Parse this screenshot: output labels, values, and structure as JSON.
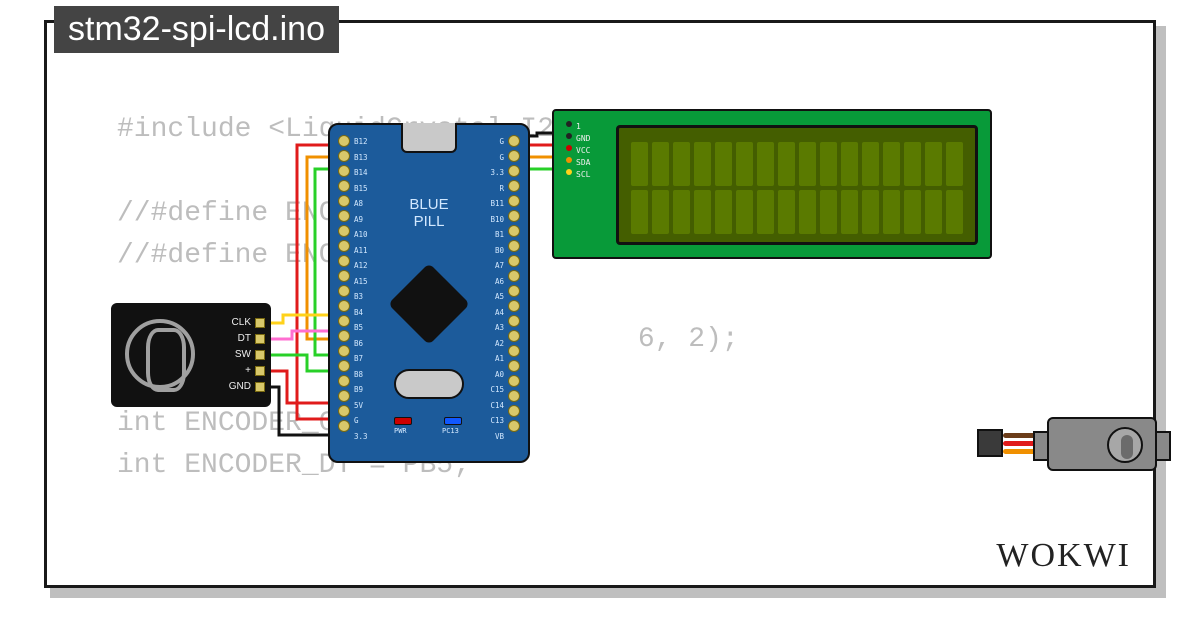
{
  "title": "stm32-spi-lcd.ino",
  "brand": "WOKWI",
  "code_lines": [
    "#include <LiquidCrystal_I2C.h>",
    "",
    "//#define ENCODER_",
    "//#define ENCODER_",
    "",
    "Liqu          I2C lcd(         6, 2);",
    "",
    "int ENCODER_CLK =   B4",
    "int ENCODER_DT = PB5;"
  ],
  "lcd": {
    "pin_labels": [
      "1",
      "GND",
      "VCC",
      "SDA",
      "SCL"
    ],
    "cols": 16,
    "rows": 2
  },
  "bluepill": {
    "label_line1": "BLUE",
    "label_line2": "PILL",
    "left_pins": [
      "B12",
      "B13",
      "B14",
      "B15",
      "A8",
      "A9",
      "A10",
      "A11",
      "A12",
      "A15",
      "B3",
      "B4",
      "B5",
      "B6",
      "B7",
      "B8",
      "B9",
      "5V",
      "G",
      "3.3"
    ],
    "right_pins": [
      "G",
      "G",
      "3.3",
      "R",
      "B11",
      "B10",
      "B1",
      "B0",
      "A7",
      "A6",
      "A5",
      "A4",
      "A3",
      "A2",
      "A1",
      "A0",
      "C15",
      "C14",
      "C13",
      "VB"
    ],
    "pc13_label": "PC13",
    "pwr_label": "PWR"
  },
  "encoder": {
    "pins": [
      "CLK",
      "DT",
      "SW",
      "+",
      "GND"
    ]
  },
  "wires": {
    "colors": {
      "gnd": "#111111",
      "vcc": "#e01b1b",
      "sda": "#f09000",
      "scl": "#ffd21a",
      "clk": "#ffd21a",
      "dt": "#ff6ed1",
      "sw": "#28d028",
      "plus": "#e01b1b",
      "enc_gnd": "#111111",
      "servo_sig": "#f09000",
      "servo_vcc": "#e01b1b",
      "servo_gnd": "#6b3c19"
    }
  }
}
